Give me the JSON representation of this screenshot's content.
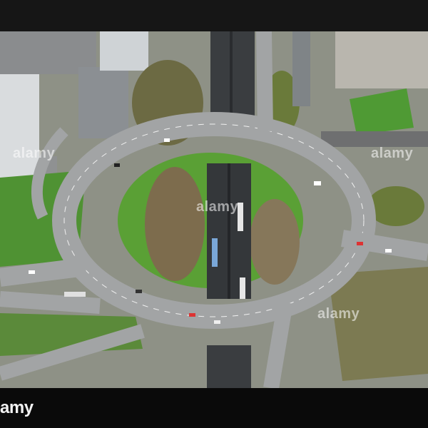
{
  "image": {
    "alt": "Aerial view of a roundabout interchange above a motorway",
    "watermark_text": "alamy",
    "brand_visible_text": "amy"
  },
  "colors": {
    "asphalt": "#9a9c9d",
    "dark_asphalt": "#3a3d40",
    "grass": "#5fa032",
    "trees": "#7a6a4a",
    "roof": "#cfd3d6",
    "bar": "#161616"
  }
}
